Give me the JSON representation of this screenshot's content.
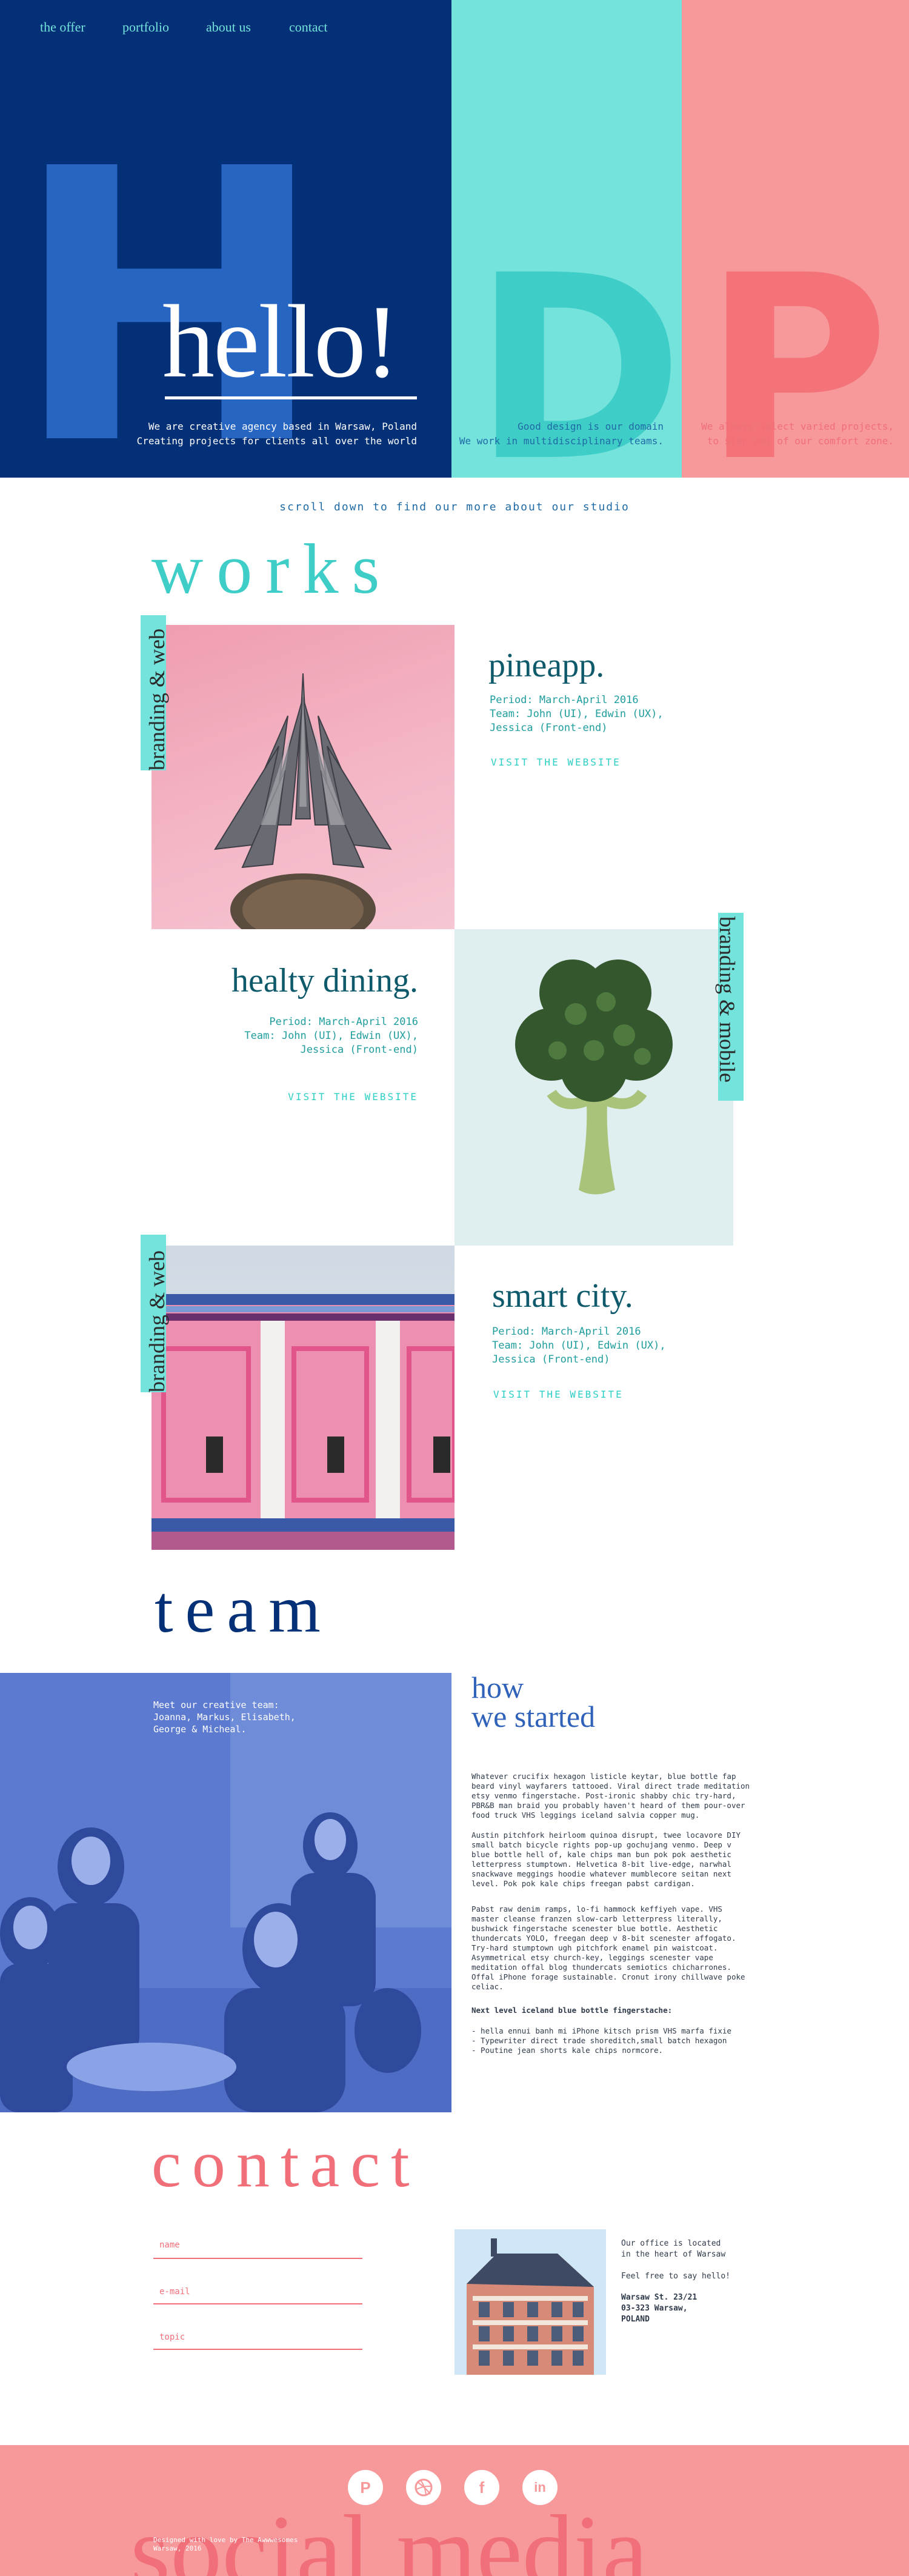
{
  "nav": {
    "items": [
      "the offer",
      "portfolio",
      "about us",
      "contact"
    ]
  },
  "hero": {
    "letters": [
      "H",
      "D",
      "P"
    ],
    "hello": "hello!",
    "tagline_1": [
      "We are creative agency based in Warsaw, Poland",
      "Creating projects for clients all over the world"
    ],
    "tagline_2": [
      "Good design is our domain",
      "We work in multidisciplinary teams."
    ],
    "tagline_3": [
      "We always select varied projects,",
      "to step out of our comfort zone."
    ]
  },
  "scroll_text": "scroll down to find our more about our studio",
  "works": {
    "title": "works",
    "projects": [
      {
        "category": "branding & web",
        "title": "pineapp.",
        "period": "Period: March-April 2016",
        "team": [
          "Team: John (UI), Edwin (UX),",
          "Jessica (Front-end)"
        ],
        "link": "VISIT THE WEBSITE"
      },
      {
        "category": "branding & mobile",
        "title": "healty dining.",
        "period": "Period: March-April 2016",
        "team": [
          "Team: John (UI), Edwin (UX),",
          "Jessica (Front-end)"
        ],
        "link": "VISIT THE WEBSITE"
      },
      {
        "category": "branding & web",
        "title": "smart city.",
        "period": "Period: March-April 2016",
        "team": [
          "Team: John (UI), Edwin (UX),",
          "Jessica (Front-end)"
        ],
        "link": "VISIT THE WEBSITE"
      }
    ]
  },
  "team": {
    "title": "team",
    "photo_caption": [
      "Meet our creative team:",
      "Joanna, Markus, Elisabeth,",
      "George & Micheal."
    ],
    "how_title": [
      "how",
      "we started"
    ],
    "paragraphs": [
      [
        "Whatever crucifix hexagon listicle keytar, blue bottle fap",
        "beard vinyl wayfarers tattooed. Viral direct trade meditation",
        "etsy venmo fingerstache. Post-ironic shabby chic try-hard,",
        "PBR&B man braid you probably haven't heard of them pour-over",
        "food truck VHS leggings iceland salvia copper mug."
      ],
      [
        "Austin pitchfork heirloom quinoa disrupt, twee locavore DIY",
        "small batch bicycle rights pop-up gochujang venmo. Deep v",
        "blue bottle hell of, kale chips man bun pok pok aesthetic",
        "letterpress stumptown. Helvetica 8-bit live-edge, narwhal",
        "snackwave meggings hoodie whatever mumblecore seitan next",
        "level. Pok pok kale chips freegan pabst cardigan."
      ],
      [
        "Pabst raw denim ramps, lo-fi hammock keffiyeh vape. VHS",
        "master cleanse franzen slow-carb letterpress literally,",
        "bushwick fingerstache scenester blue bottle. Aesthetic",
        "thundercats YOLO, freegan deep v 8-bit scenester affogato.",
        "Try-hard stumptown ugh pitchfork enamel pin waistcoat.",
        "Asymmetrical etsy church-key, leggings scenester vape",
        "meditation offal blog thundercats semiotics chicharrones.",
        "Offal iPhone forage sustainable. Cronut irony chillwave poke",
        "celiac."
      ]
    ],
    "bold_line": "Next level iceland blue bottle fingerstache:",
    "list": [
      "- hella ennui banh mi iPhone kitsch prism VHS marfa fixie",
      "- Typewriter direct trade shoreditch,small batch hexagon",
      "- Poutine jean shorts kale chips normcore."
    ]
  },
  "contact": {
    "title": "contact",
    "fields": [
      "name",
      "e-mail",
      "topic"
    ],
    "info": [
      "Our office is located",
      "in the heart of Warsaw",
      "",
      "Feel free to say hello!"
    ],
    "address": [
      "Warsaw St. 23/21",
      "03-323 Warsaw,",
      "POLAND"
    ]
  },
  "footer": {
    "social": [
      "pinterest-icon",
      "dribbble-icon",
      "facebook-icon",
      "linkedin-icon"
    ],
    "watermark": "social media",
    "credit": [
      "Designed with love by The Awwwesomes",
      "Warsaw, 2016"
    ]
  },
  "colors": {
    "navy": "#043078",
    "turquoise": "#73e3dc",
    "pink": "#f7989b",
    "coral": "#f06f79",
    "teal_text": "#0e5a6b"
  }
}
